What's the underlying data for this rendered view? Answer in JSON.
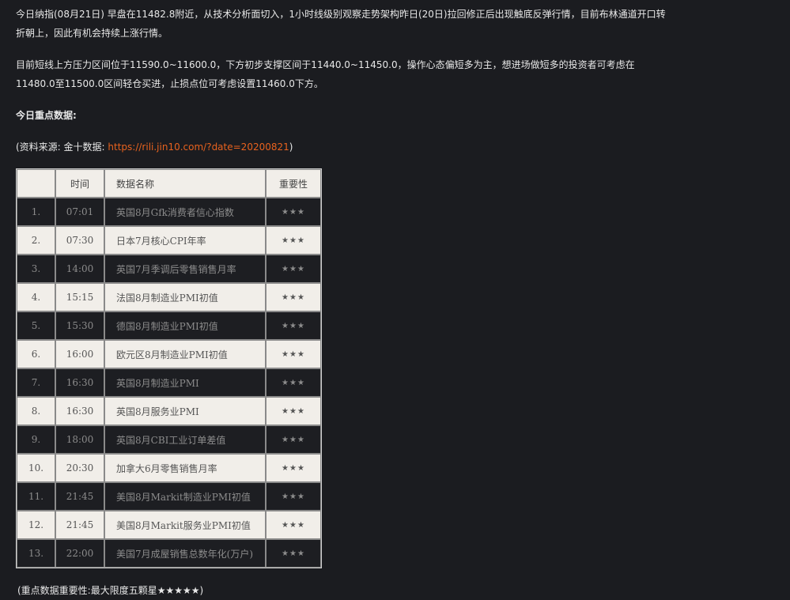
{
  "article": {
    "paragraph1": "今日纳指(08月21日) 早盘在11482.8附近，从技术分析面切入，1小时线级别观察走势架构昨日(20日)拉回修正后出现触底反弹行情，目前布林通道开口转折朝上，因此有机会持续上涨行情。",
    "paragraph2": "目前短线上方压力区间位于11590.0~11600.0，下方初步支撑区间于11440.0~11450.0，操作心态偏短多为主，想进场做短多的投资者可考虑在11480.0至11500.0区间轻仓买进，止损点位可考虑设置11460.0下方。",
    "heading": "今日重点数据:",
    "source_prefix": "(资料来源: 金十数据: ",
    "source_link": "https://rili.jin10.com/?date=20200821",
    "source_suffix": ")",
    "note": "(重点数据重要性:最大限度五颗星★★★★★)"
  },
  "table": {
    "headers": {
      "no": "",
      "time": "时间",
      "name": "数据名称",
      "importance": "重要性"
    },
    "rows": [
      {
        "no": "1.",
        "time": "07:01",
        "name": "英国8月Gfk消费者信心指数",
        "stars": "★★★"
      },
      {
        "no": "2.",
        "time": "07:30",
        "name": "日本7月核心CPI年率",
        "stars": "★★★"
      },
      {
        "no": "3.",
        "time": "14:00",
        "name": "英国7月季调后零售销售月率",
        "stars": "★★★"
      },
      {
        "no": "4.",
        "time": "15:15",
        "name": "法国8月制造业PMI初值",
        "stars": "★★★"
      },
      {
        "no": "5.",
        "time": "15:30",
        "name": "德国8月制造业PMI初值",
        "stars": "★★★"
      },
      {
        "no": "6.",
        "time": "16:00",
        "name": "欧元区8月制造业PMI初值",
        "stars": "★★★"
      },
      {
        "no": "7.",
        "time": "16:30",
        "name": "英国8月制造业PMI",
        "stars": "★★★"
      },
      {
        "no": "8.",
        "time": "16:30",
        "name": "英国8月服务业PMI",
        "stars": "★★★"
      },
      {
        "no": "9.",
        "time": "18:00",
        "name": "英国8月CBI工业订单差值",
        "stars": "★★★"
      },
      {
        "no": "10.",
        "time": "20:30",
        "name": "加拿大6月零售销售月率",
        "stars": "★★★"
      },
      {
        "no": "11.",
        "time": "21:45",
        "name": "美国8月Markit制造业PMI初值",
        "stars": "★★★"
      },
      {
        "no": "12.",
        "time": "21:45",
        "name": "美国8月Markit服务业PMI初值",
        "stars": "★★★"
      },
      {
        "no": "13.",
        "time": "22:00",
        "name": "美国7月成屋销售总数年化(万户)",
        "stars": "★★★"
      }
    ]
  }
}
